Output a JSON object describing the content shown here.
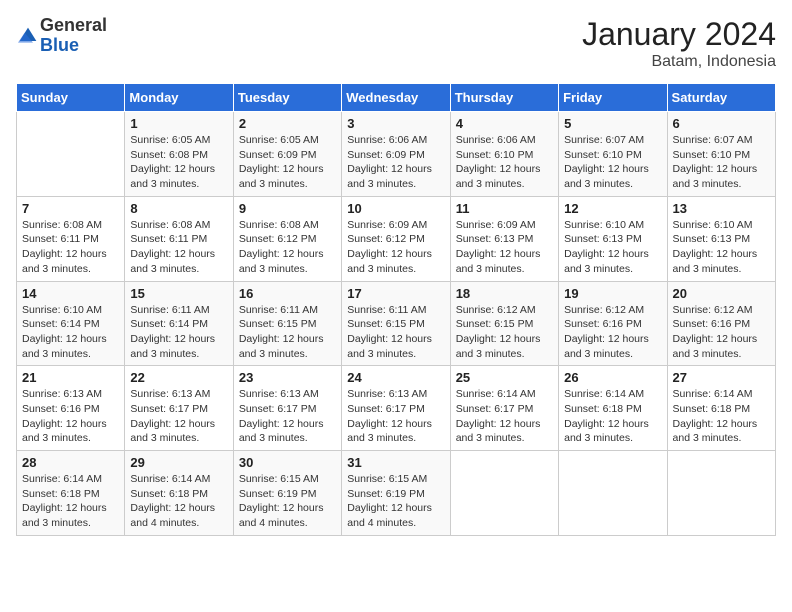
{
  "logo": {
    "text_general": "General",
    "text_blue": "Blue"
  },
  "title": "January 2024",
  "subtitle": "Batam, Indonesia",
  "days_header": [
    "Sunday",
    "Monday",
    "Tuesday",
    "Wednesday",
    "Thursday",
    "Friday",
    "Saturday"
  ],
  "weeks": [
    [
      {
        "num": "",
        "info": ""
      },
      {
        "num": "1",
        "info": "Sunrise: 6:05 AM\nSunset: 6:08 PM\nDaylight: 12 hours\nand 3 minutes."
      },
      {
        "num": "2",
        "info": "Sunrise: 6:05 AM\nSunset: 6:09 PM\nDaylight: 12 hours\nand 3 minutes."
      },
      {
        "num": "3",
        "info": "Sunrise: 6:06 AM\nSunset: 6:09 PM\nDaylight: 12 hours\nand 3 minutes."
      },
      {
        "num": "4",
        "info": "Sunrise: 6:06 AM\nSunset: 6:10 PM\nDaylight: 12 hours\nand 3 minutes."
      },
      {
        "num": "5",
        "info": "Sunrise: 6:07 AM\nSunset: 6:10 PM\nDaylight: 12 hours\nand 3 minutes."
      },
      {
        "num": "6",
        "info": "Sunrise: 6:07 AM\nSunset: 6:10 PM\nDaylight: 12 hours\nand 3 minutes."
      }
    ],
    [
      {
        "num": "7",
        "info": "Sunrise: 6:08 AM\nSunset: 6:11 PM\nDaylight: 12 hours\nand 3 minutes."
      },
      {
        "num": "8",
        "info": "Sunrise: 6:08 AM\nSunset: 6:11 PM\nDaylight: 12 hours\nand 3 minutes."
      },
      {
        "num": "9",
        "info": "Sunrise: 6:08 AM\nSunset: 6:12 PM\nDaylight: 12 hours\nand 3 minutes."
      },
      {
        "num": "10",
        "info": "Sunrise: 6:09 AM\nSunset: 6:12 PM\nDaylight: 12 hours\nand 3 minutes."
      },
      {
        "num": "11",
        "info": "Sunrise: 6:09 AM\nSunset: 6:13 PM\nDaylight: 12 hours\nand 3 minutes."
      },
      {
        "num": "12",
        "info": "Sunrise: 6:10 AM\nSunset: 6:13 PM\nDaylight: 12 hours\nand 3 minutes."
      },
      {
        "num": "13",
        "info": "Sunrise: 6:10 AM\nSunset: 6:13 PM\nDaylight: 12 hours\nand 3 minutes."
      }
    ],
    [
      {
        "num": "14",
        "info": "Sunrise: 6:10 AM\nSunset: 6:14 PM\nDaylight: 12 hours\nand 3 minutes."
      },
      {
        "num": "15",
        "info": "Sunrise: 6:11 AM\nSunset: 6:14 PM\nDaylight: 12 hours\nand 3 minutes."
      },
      {
        "num": "16",
        "info": "Sunrise: 6:11 AM\nSunset: 6:15 PM\nDaylight: 12 hours\nand 3 minutes."
      },
      {
        "num": "17",
        "info": "Sunrise: 6:11 AM\nSunset: 6:15 PM\nDaylight: 12 hours\nand 3 minutes."
      },
      {
        "num": "18",
        "info": "Sunrise: 6:12 AM\nSunset: 6:15 PM\nDaylight: 12 hours\nand 3 minutes."
      },
      {
        "num": "19",
        "info": "Sunrise: 6:12 AM\nSunset: 6:16 PM\nDaylight: 12 hours\nand 3 minutes."
      },
      {
        "num": "20",
        "info": "Sunrise: 6:12 AM\nSunset: 6:16 PM\nDaylight: 12 hours\nand 3 minutes."
      }
    ],
    [
      {
        "num": "21",
        "info": "Sunrise: 6:13 AM\nSunset: 6:16 PM\nDaylight: 12 hours\nand 3 minutes."
      },
      {
        "num": "22",
        "info": "Sunrise: 6:13 AM\nSunset: 6:17 PM\nDaylight: 12 hours\nand 3 minutes."
      },
      {
        "num": "23",
        "info": "Sunrise: 6:13 AM\nSunset: 6:17 PM\nDaylight: 12 hours\nand 3 minutes."
      },
      {
        "num": "24",
        "info": "Sunrise: 6:13 AM\nSunset: 6:17 PM\nDaylight: 12 hours\nand 3 minutes."
      },
      {
        "num": "25",
        "info": "Sunrise: 6:14 AM\nSunset: 6:17 PM\nDaylight: 12 hours\nand 3 minutes."
      },
      {
        "num": "26",
        "info": "Sunrise: 6:14 AM\nSunset: 6:18 PM\nDaylight: 12 hours\nand 3 minutes."
      },
      {
        "num": "27",
        "info": "Sunrise: 6:14 AM\nSunset: 6:18 PM\nDaylight: 12 hours\nand 3 minutes."
      }
    ],
    [
      {
        "num": "28",
        "info": "Sunrise: 6:14 AM\nSunset: 6:18 PM\nDaylight: 12 hours\nand 3 minutes."
      },
      {
        "num": "29",
        "info": "Sunrise: 6:14 AM\nSunset: 6:18 PM\nDaylight: 12 hours\nand 4 minutes."
      },
      {
        "num": "30",
        "info": "Sunrise: 6:15 AM\nSunset: 6:19 PM\nDaylight: 12 hours\nand 4 minutes."
      },
      {
        "num": "31",
        "info": "Sunrise: 6:15 AM\nSunset: 6:19 PM\nDaylight: 12 hours\nand 4 minutes."
      },
      {
        "num": "",
        "info": ""
      },
      {
        "num": "",
        "info": ""
      },
      {
        "num": "",
        "info": ""
      }
    ]
  ]
}
